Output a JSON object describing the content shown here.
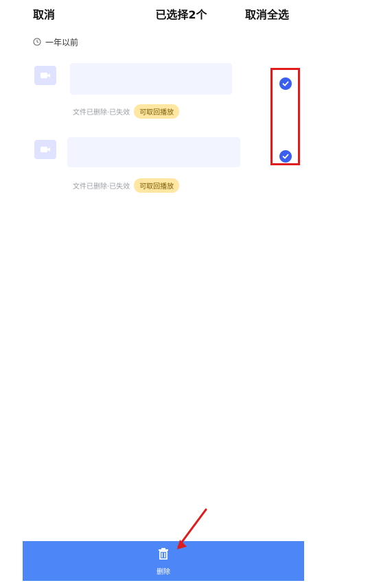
{
  "header": {
    "cancel_label": "取消",
    "title": "已选择2个",
    "deselect_all_label": "取消全选"
  },
  "group": {
    "label": "一年以前"
  },
  "rows": [
    {
      "meta_text": "文件已删除·已失效",
      "badge_text": "可取回播放",
      "selected": true
    },
    {
      "meta_text": "文件已删除·已失效",
      "badge_text": "可取回播放",
      "selected": true
    }
  ],
  "footer": {
    "delete_label": "删除"
  },
  "colors": {
    "accent": "#3a5ef0",
    "bottom_bar": "#4c86f7",
    "badge_bg": "#ffe7a3",
    "annotation_red": "#e01b1b"
  },
  "icons": {
    "group_icon": "clock-icon",
    "row_icon": "video-icon",
    "selected_icon": "check-circle-icon",
    "footer_icon": "trash-icon"
  }
}
